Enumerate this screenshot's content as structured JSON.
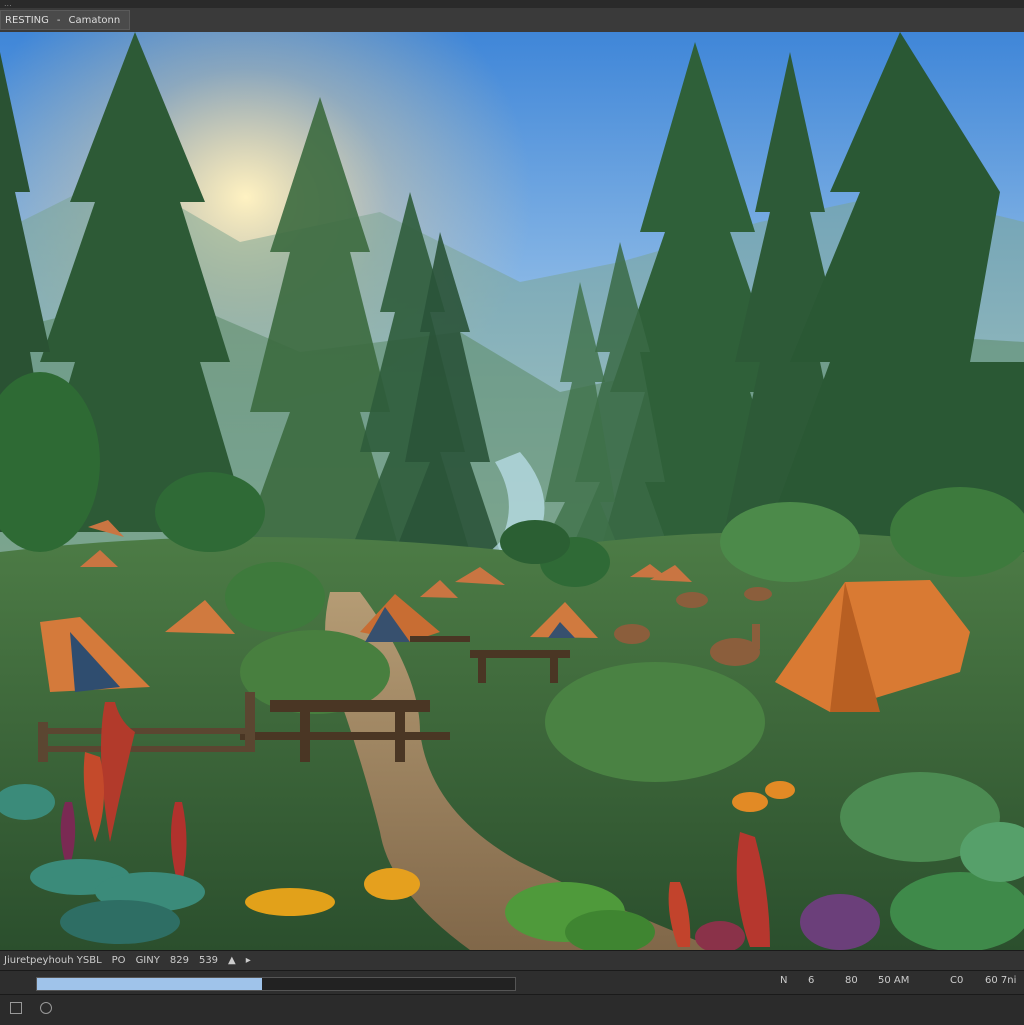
{
  "app": {
    "title_strip": "...",
    "toolbar": {
      "mode_label": "RESTING",
      "separator": "-",
      "name": "Camatonn"
    }
  },
  "scene": {
    "description_alt": "Campsite forest scene",
    "sky_top": "#3f86d8",
    "sky_bottom": "#cfe6f2",
    "foliage": "#2f6b3a",
    "tent": "#d97a33"
  },
  "statusbar": {
    "left_text": "Jiuretpeyhouh YSBL",
    "code1": "PO",
    "code2": "GINY",
    "num1": "829",
    "num2": "539",
    "arrow_left": "▲",
    "arrow_right": "▸"
  },
  "timeline": {
    "progress": 0.47,
    "labels": [
      "N",
      "6",
      "80",
      "50 AM",
      "C0",
      "60 7ni"
    ]
  }
}
